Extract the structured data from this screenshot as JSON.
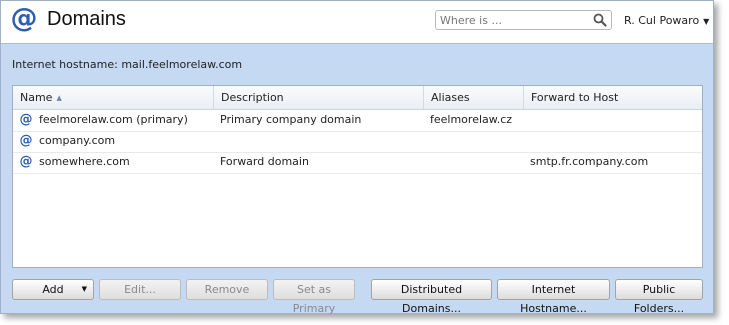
{
  "header": {
    "app_icon": "@",
    "title": "Domains",
    "search_placeholder": "Where is ...",
    "search_icon": "search-icon",
    "user_name": "R. Cul Powaro",
    "user_caret": "▼"
  },
  "hostname_line": "Internet hostname: mail.feelmorelaw.com",
  "table": {
    "columns": [
      {
        "label": "Name",
        "sort": "▲"
      },
      {
        "label": "Description"
      },
      {
        "label": "Aliases"
      },
      {
        "label": "Forward to Host"
      }
    ],
    "rows": [
      {
        "icon": "@",
        "name": "feelmorelaw.com (primary)",
        "description": "Primary company domain",
        "aliases": "feelmorelaw.cz",
        "forward": ""
      },
      {
        "icon": "@",
        "name": "company.com",
        "description": "",
        "aliases": "",
        "forward": ""
      },
      {
        "icon": "@",
        "name": "somewhere.com",
        "description": "Forward domain",
        "aliases": "",
        "forward": "smtp.fr.company.com"
      }
    ]
  },
  "buttons": {
    "add": "Add",
    "add_caret": "▼",
    "edit": "Edit...",
    "remove": "Remove",
    "set_primary": "Set as Primary",
    "distributed": "Distributed Domains...",
    "internet_hostname": "Internet Hostname...",
    "public_folders": "Public Folders..."
  },
  "colors": {
    "accent": "#2e5fae",
    "panel_bg": "#c5d9f3"
  }
}
